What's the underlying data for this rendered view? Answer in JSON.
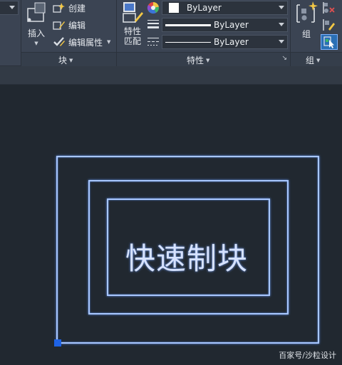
{
  "ribbon": {
    "block_panel": {
      "title": "块",
      "insert_label": "插入",
      "create_label": "创建",
      "edit_label": "编辑",
      "edit_attributes_label": "编辑属性"
    },
    "properties_panel": {
      "title": "特性",
      "match_line1": "特性",
      "match_line2": "匹配",
      "color_value": "ByLayer",
      "lineweight_value": "ByLayer",
      "linetype_value": "ByLayer"
    },
    "group_panel": {
      "title": "组",
      "group_label": "组"
    }
  },
  "canvas": {
    "block_text": "快速制块"
  },
  "watermark": "百家号/沙粒设计",
  "colors": {
    "ribbon_bg": "#3b4453",
    "canvas_bg": "#212830",
    "geometry_stroke": "#a8c6ff",
    "grip": "#1e63e6"
  }
}
